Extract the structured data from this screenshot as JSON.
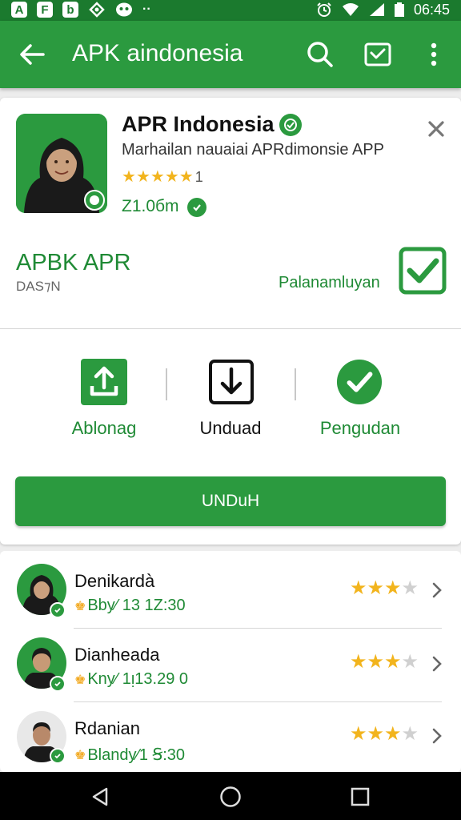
{
  "status_bar": {
    "left_icons": [
      "A",
      "F",
      "b",
      "wifi-location",
      "face"
    ],
    "dots": "··",
    "time": "06:45"
  },
  "app_bar": {
    "title": "APK aindonesia",
    "icons": [
      "back-arrow-icon",
      "search-icon",
      "inbox-check-icon",
      "more-vert-icon"
    ]
  },
  "app": {
    "name": "APR Indonesia",
    "subtitle": "Marhailan nauaiai APRdimonsie APP",
    "rating_stars": 5,
    "rating_count": "1",
    "size": "Z1.0бm"
  },
  "section": {
    "title": "APBK APR",
    "subtitle": "DAS⁊N",
    "right_label": "Palanamluyan"
  },
  "actions": [
    {
      "label": "Ablonag",
      "icon": "upload-icon"
    },
    {
      "label": "Unduad",
      "icon": "download-icon"
    },
    {
      "label": "Pengudan",
      "icon": "check-circle-icon"
    }
  ],
  "cta": {
    "label": "UNDuH"
  },
  "reviews": [
    {
      "name": "Denikardà",
      "meta": "Bby⁄ 13 1Z:30",
      "stars": 3
    },
    {
      "name": "Dianheada",
      "meta": "Kny⁄ 1ᴉ13.29 0",
      "stars": 3
    },
    {
      "name": "Rdanian",
      "meta": "Blandy⁄1 Ꞩ:30",
      "stars": 3
    }
  ],
  "colors": {
    "primary": "#2b9a3f",
    "primary_dark": "#1b7a2e",
    "text_green": "#1f8a35",
    "star": "#f2b41d",
    "star_empty": "#d0d0d0"
  },
  "nav": [
    "back-triangle-icon",
    "home-circle-icon",
    "recents-square-icon"
  ]
}
